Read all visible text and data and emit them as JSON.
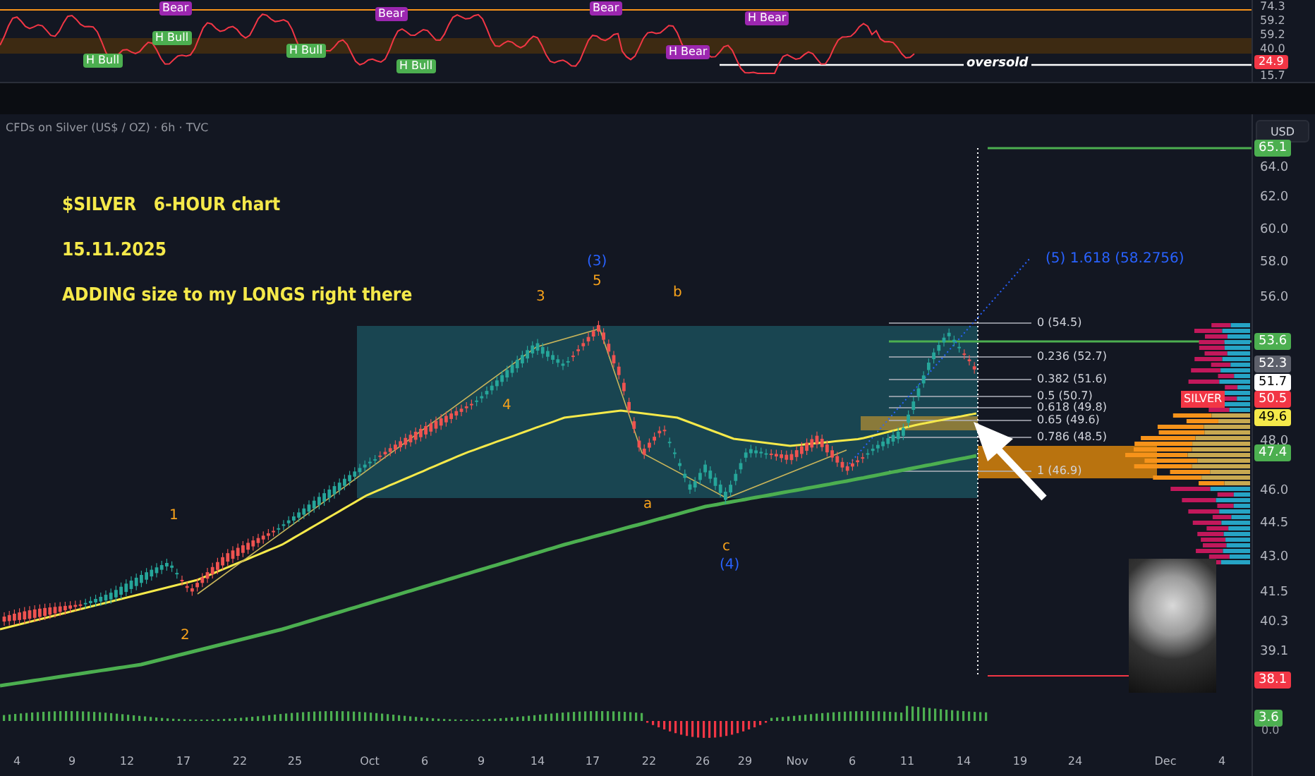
{
  "header": {
    "title": "CFDs on Silver (US$ / OZ) · 6h · TVC",
    "currency_button": "USD"
  },
  "rsi": {
    "labels": [
      {
        "kind": "bull",
        "text": "H Bull"
      },
      {
        "kind": "bull",
        "text": "H Bull"
      },
      {
        "kind": "bear",
        "text": "Bear"
      },
      {
        "kind": "bull",
        "text": "H Bull"
      },
      {
        "kind": "bear",
        "text": "Bear"
      },
      {
        "kind": "bull",
        "text": "H Bull"
      },
      {
        "kind": "bear",
        "text": "Bear"
      },
      {
        "kind": "bear",
        "text": "H Bear"
      },
      {
        "kind": "bear",
        "text": "H Bear"
      }
    ],
    "oversold_label": "oversold",
    "axis": [
      "74.3",
      "59.2",
      "59.2",
      "40.0",
      "15.7"
    ],
    "current_tag": {
      "text": "24.9",
      "color": "#f23645"
    }
  },
  "chart": {
    "notes": [
      "$SILVER   6-HOUR chart",
      "15.11.2025",
      "ADDING size to my LONGS right there"
    ],
    "waves": [
      {
        "text": "1",
        "color": "#f7a21b"
      },
      {
        "text": "2",
        "color": "#f7a21b"
      },
      {
        "text": "3",
        "color": "#f7a21b"
      },
      {
        "text": "(3)",
        "color": "#2962ff"
      },
      {
        "text": "5",
        "color": "#f7a21b"
      },
      {
        "text": "4",
        "color": "#f7a21b"
      },
      {
        "text": "b",
        "color": "#f7a21b"
      },
      {
        "text": "a",
        "color": "#f7a21b"
      },
      {
        "text": "c",
        "color": "#f7a21b"
      },
      {
        "text": "(4)",
        "color": "#2962ff"
      }
    ],
    "projection": "(5) 1.618 (58.2756)",
    "fib_levels": [
      "0 (54.5)",
      "0.236 (52.7)",
      "0.382 (51.6)",
      "0.5 (50.7)",
      "0.618 (49.8)",
      "0.65 (49.6)",
      "0.786 (48.5)",
      "1 (46.9)"
    ],
    "axis": [
      "64.0",
      "62.0",
      "60.0",
      "58.0",
      "56.0",
      "48.0",
      "46.0",
      "44.5",
      "43.0",
      "41.5",
      "40.3",
      "39.1"
    ],
    "price_tags": [
      {
        "text": "65.1",
        "color": "#4caf50"
      },
      {
        "text": "53.6",
        "color": "#4caf50"
      },
      {
        "text": "52.3",
        "color": "#5d606b"
      },
      {
        "text": "51.7",
        "color": "#ffffff"
      },
      {
        "text": "50.5",
        "color": "#f23645"
      },
      {
        "text": "49.6",
        "color": "#f5e94a"
      },
      {
        "text": "47.4",
        "color": "#4caf50"
      },
      {
        "text": "38.1",
        "color": "#f23645"
      }
    ],
    "symbol_tag": "SILVER"
  },
  "macd": {
    "tag": "3.6",
    "zero": "0.0"
  },
  "dates": [
    "4",
    "9",
    "12",
    "17",
    "22",
    "25",
    "Oct",
    "6",
    "9",
    "14",
    "17",
    "22",
    "26",
    "29",
    "Nov",
    "6",
    "11",
    "14",
    "19",
    "24",
    "Dec",
    "4"
  ]
}
